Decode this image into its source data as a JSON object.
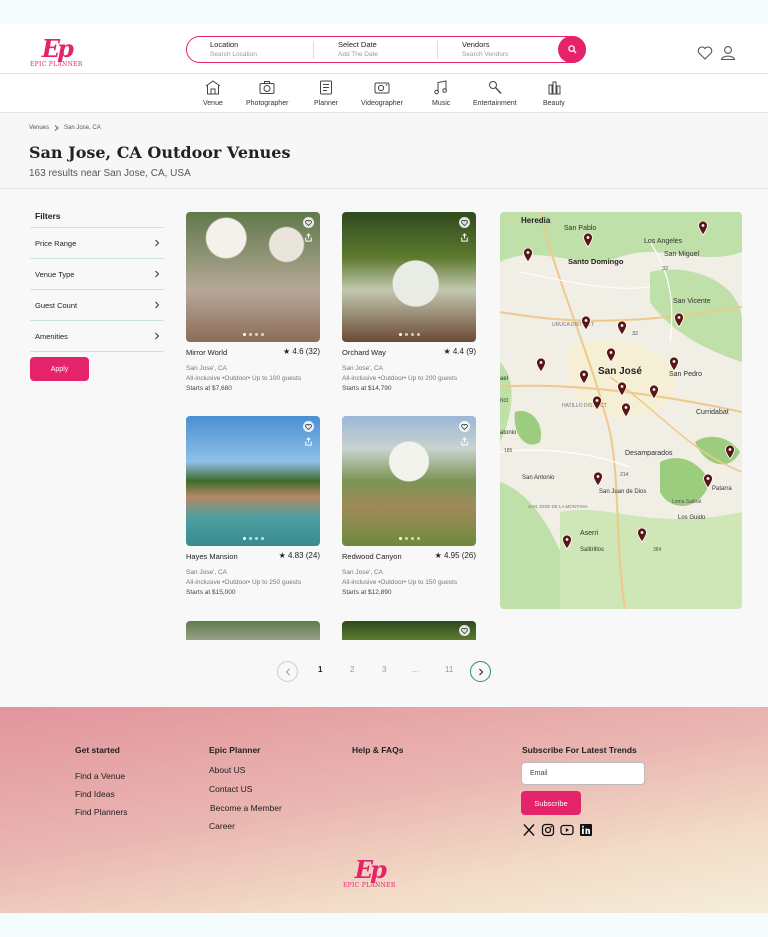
{
  "brand": {
    "mark": "Ep",
    "name": "EPIC PLANNER"
  },
  "search": {
    "location_title": "Location",
    "location_placeholder": "Search Location",
    "date_title": "Select Date",
    "date_placeholder": "Add The Date",
    "vendor_title": "Vendors",
    "vendor_placeholder": "Search Vendors",
    "button_icon": "search-icon"
  },
  "header_icons": [
    "heart-icon",
    "user-icon"
  ],
  "categories": [
    {
      "label": "Venue",
      "icon": "venue-icon"
    },
    {
      "label": "Photographer",
      "icon": "camera-icon"
    },
    {
      "label": "Planner",
      "icon": "planner-icon"
    },
    {
      "label": "Videographer",
      "icon": "video-camera-icon"
    },
    {
      "label": "Music",
      "icon": "music-icon"
    },
    {
      "label": "Entertainment",
      "icon": "entertainment-icon"
    },
    {
      "label": "Beauty",
      "icon": "beauty-icon"
    }
  ],
  "breadcrumb": {
    "parent": "Venues",
    "current": "San Jose, CA"
  },
  "page": {
    "title": "San  Jose, CA Outdoor Venues",
    "results": "163 results near San Jose, CA, USA"
  },
  "filters": {
    "heading": "Filters",
    "items": [
      "Price Range",
      "Venue Type",
      "Guest Count",
      "Amenities"
    ],
    "apply_label": "Apply"
  },
  "venues": [
    {
      "name": "Mirror World",
      "rating": "4.6 (32)",
      "location": "San Jose', CA",
      "description": "All-inclusive •Outdoor• Up to 100 guests",
      "price": "Starts at $7,680"
    },
    {
      "name": "Orchard Way",
      "rating": "4.4 (9)",
      "location": "San Jose', CA",
      "description": "All-inclusive •Outdoor• Up to 200 guests",
      "price": "Starts at $14,790"
    },
    {
      "name": "Hayes Mansion",
      "rating": "4.83 (24)",
      "location": "San Jose', CA",
      "description": "All-inclusive •Outdoor• Up to 250 guests",
      "price": "Starts at $15,000"
    },
    {
      "name": "Redwood Canyon",
      "rating": "4.95 (26)",
      "location": "San Jose', CA",
      "description": "All-inclusive •Outdoor• Up to 150 guests",
      "price": "Starts at $12,890"
    }
  ],
  "map": {
    "labels": [
      "Heredia",
      "San Pablo",
      "Los Angeles",
      "San Miguel",
      "Santo Domingo",
      "32",
      "San Vicente",
      "URUCA DISTRICT",
      "32",
      "San José",
      "San Pedro",
      "ael",
      "HATILLO DISTRICT",
      "rict",
      "Curridabat",
      "atonio",
      "185",
      "Desamparados",
      "San Antonio",
      "214",
      "San Juan de Dios",
      "Patarra",
      "Loma Salitral",
      "Los Guido",
      "SAN JOSE DE LA MONTANA",
      "Aserri",
      "Salitrillos",
      "384"
    ]
  },
  "pagination": {
    "pages": [
      "1",
      "2",
      "3",
      "...",
      "11"
    ],
    "current": "1"
  },
  "footer": {
    "col1": {
      "heading": "Get started",
      "links": [
        "Find a Venue",
        "Find Ideas",
        "Find Planners"
      ]
    },
    "col2": {
      "heading": "Epic Planner",
      "links": [
        "About US",
        "Contact US",
        "Become a Member",
        "Career"
      ]
    },
    "col3": {
      "heading": "Help & FAQs"
    },
    "col4": {
      "heading": "Subscribe For Latest Trends",
      "email_placeholder": "Email",
      "subscribe_label": "Subscribe"
    },
    "social": [
      "x-icon",
      "instagram-icon",
      "youtube-icon",
      "linkedin-icon"
    ]
  },
  "colors": {
    "accent": "#e5236b",
    "pin": "#5a1515",
    "map_green": "#bfe0a8",
    "map_base": "#f1eee6"
  }
}
